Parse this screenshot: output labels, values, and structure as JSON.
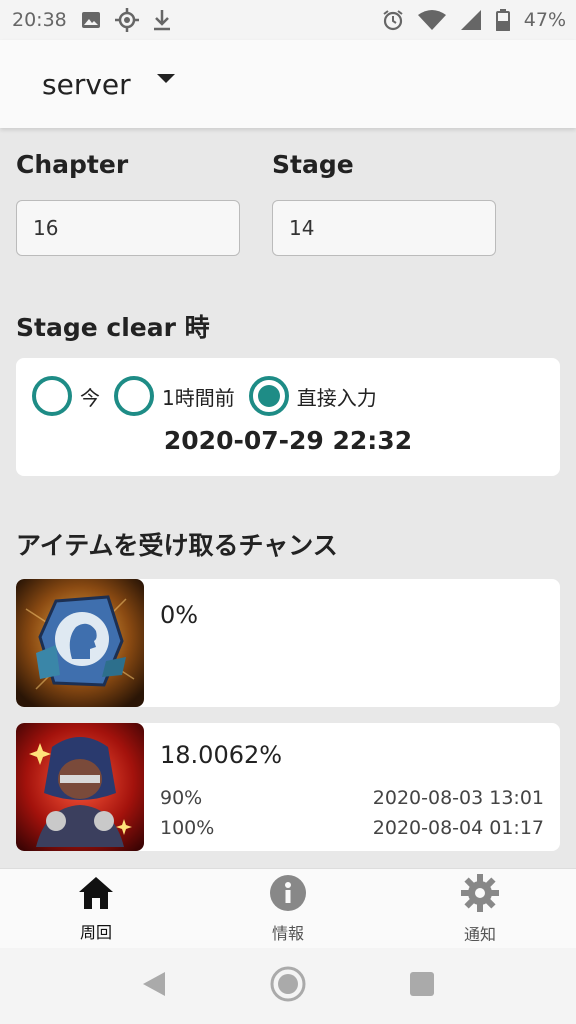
{
  "status_bar": {
    "time": "20:38",
    "battery": "47%",
    "left_icons": [
      "image-icon",
      "gps-icon",
      "download-icon"
    ],
    "right_icons": [
      "alarm-icon",
      "wifi-icon",
      "signal-icon",
      "battery-icon"
    ]
  },
  "app_bar": {
    "server_label": "server"
  },
  "form": {
    "chapter_label": "Chapter",
    "chapter_value": "16",
    "stage_label": "Stage",
    "stage_value": "14"
  },
  "clear_time": {
    "title": "Stage clear 時",
    "options": [
      {
        "label": "今",
        "selected": false
      },
      {
        "label": "1時間前",
        "selected": false
      },
      {
        "label": "直接入力",
        "selected": true
      }
    ],
    "datetime": "2020-07-29 22:32"
  },
  "items_section": {
    "title": "アイテムを受け取るチャンス",
    "items": [
      {
        "icon": "stone-icon",
        "percent": "0%"
      },
      {
        "icon": "hero-card-icon",
        "percent": "18.0062%",
        "rows": [
          {
            "label": "90%",
            "date": "2020-08-03 13:01"
          },
          {
            "label": "100%",
            "date": "2020-08-04 01:17"
          }
        ]
      }
    ]
  },
  "bottom_nav": {
    "items": [
      {
        "label": "周回",
        "icon": "home-icon",
        "active": true
      },
      {
        "label": "情報",
        "icon": "info-icon",
        "active": false
      },
      {
        "label": "通知",
        "icon": "gear-icon",
        "active": false
      }
    ]
  },
  "colors": {
    "accent": "#1e8c86",
    "background": "#e8e8e8",
    "card": "#ffffff"
  }
}
